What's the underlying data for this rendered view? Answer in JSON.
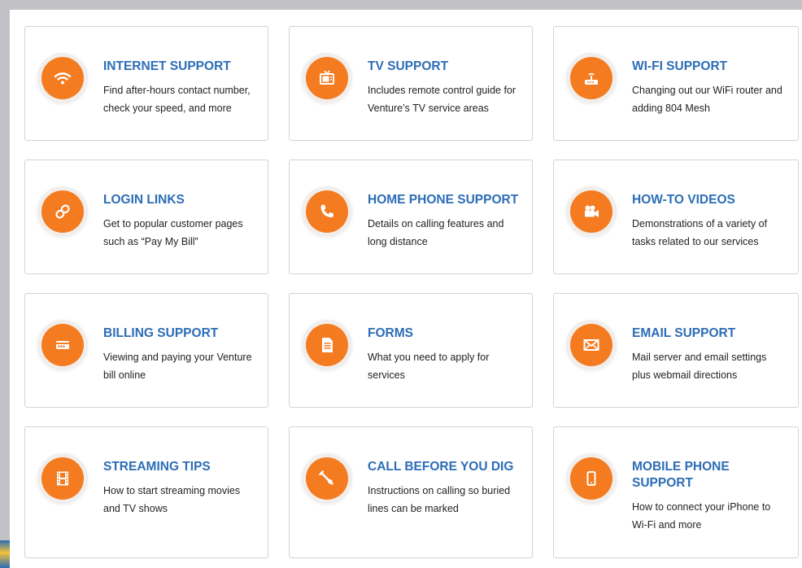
{
  "accent_color": "#f47b20",
  "title_color": "#2c6db6",
  "cards": [
    {
      "title": "INTERNET SUPPORT",
      "desc": "Find after-hours contact number, check your speed, and more",
      "icon": "wifi-icon"
    },
    {
      "title": "TV SUPPORT",
      "desc": "Includes remote control guide for Venture’s TV service areas",
      "icon": "tv-icon"
    },
    {
      "title": "WI-FI SUPPORT",
      "desc": "Changing out our WiFi router and adding 804 Mesh",
      "icon": "router-icon"
    },
    {
      "title": "LOGIN LINKS",
      "desc": "Get to popular customer pages such as “Pay My Bill”",
      "icon": "link-icon"
    },
    {
      "title": "HOME PHONE SUPPORT",
      "desc": "Details on calling features and long distance",
      "icon": "phone-icon"
    },
    {
      "title": "HOW-TO VIDEOS",
      "desc": "Demonstrations of a variety of tasks related to our services",
      "icon": "video-camera-icon"
    },
    {
      "title": "BILLING SUPPORT",
      "desc": "Viewing and paying your Venture bill online",
      "icon": "credit-card-icon"
    },
    {
      "title": "FORMS",
      "desc": "What you need to apply for services",
      "icon": "document-icon"
    },
    {
      "title": "EMAIL SUPPORT",
      "desc": "Mail server and email settings plus webmail directions",
      "icon": "envelope-icon"
    },
    {
      "title": "STREAMING TIPS",
      "desc": "How to start streaming movies and TV shows",
      "icon": "film-icon"
    },
    {
      "title": "CALL BEFORE YOU DIG",
      "desc": "Instructions on calling so buried lines can be marked",
      "icon": "shovel-icon"
    },
    {
      "title": "MOBILE PHONE SUPPORT",
      "desc": "How to connect your iPhone to Wi-Fi and more",
      "icon": "mobile-phone-icon"
    }
  ]
}
